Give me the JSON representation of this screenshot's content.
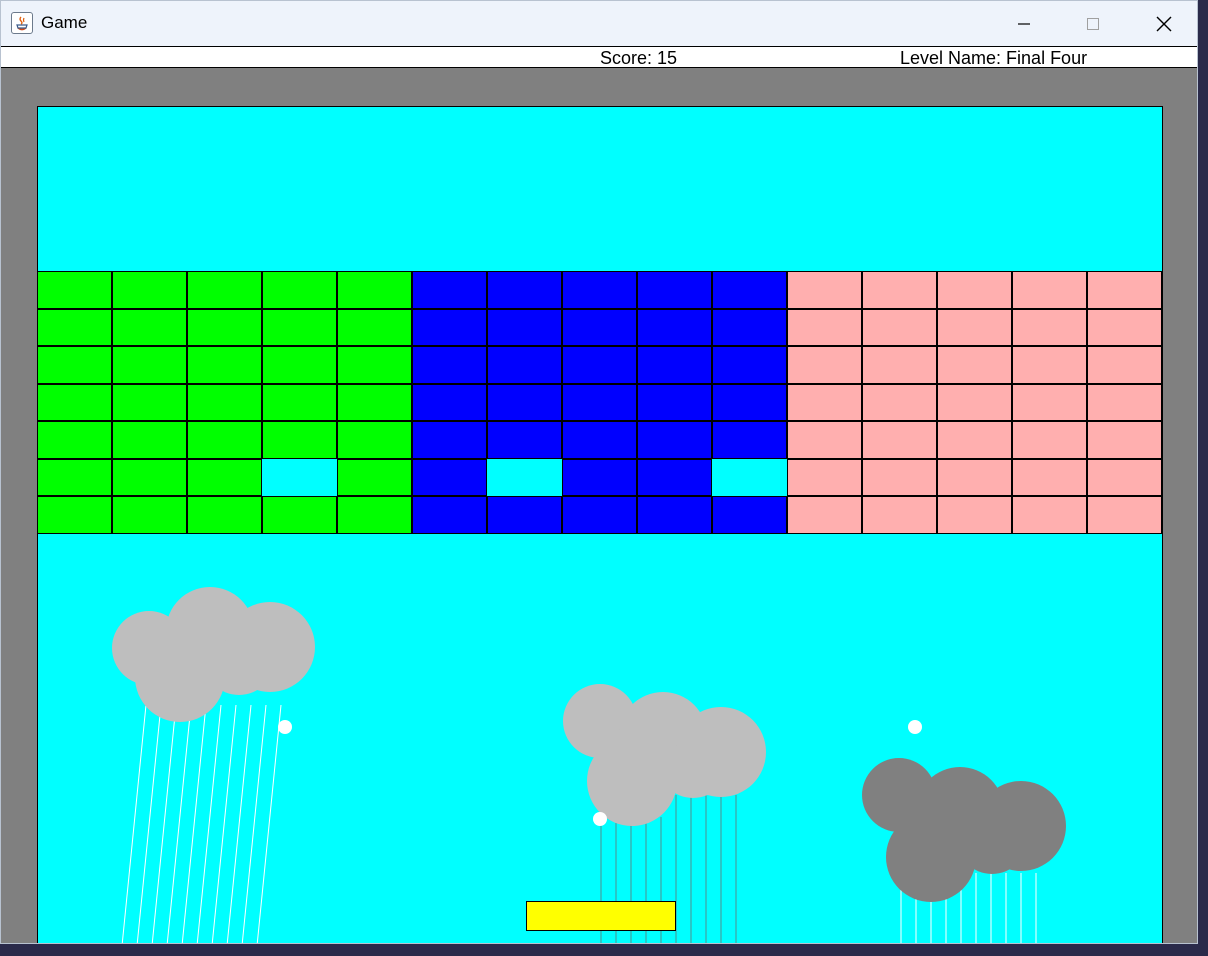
{
  "window": {
    "title": "Game",
    "controls": {
      "minimize": "minimize-icon",
      "maximize": "maximize-icon",
      "close": "close-icon"
    }
  },
  "hud": {
    "score": "Score: 15",
    "level": "Level Name: Final Four"
  },
  "colors": {
    "field": "#00ffff",
    "walls": "#808080",
    "paddle": "#ffff00",
    "ball": "#ffffff",
    "brick_green": "#00ff00",
    "brick_blue": "#0000ff",
    "brick_pink": "#ffafaf",
    "cloud_light": "#bebebe",
    "cloud_dark": "#808080"
  },
  "bricks": {
    "columns": 15,
    "rows": 7,
    "column_colors": [
      "green",
      "green",
      "green",
      "green",
      "green",
      "blue",
      "blue",
      "blue",
      "blue",
      "blue",
      "pink",
      "pink",
      "pink",
      "pink",
      "pink"
    ],
    "missing": [
      [
        6,
        4
      ],
      [
        6,
        7
      ],
      [
        6,
        10
      ]
    ]
  },
  "balls": 3,
  "clouds": [
    {
      "shade": "light"
    },
    {
      "shade": "light"
    },
    {
      "shade": "dark"
    }
  ]
}
